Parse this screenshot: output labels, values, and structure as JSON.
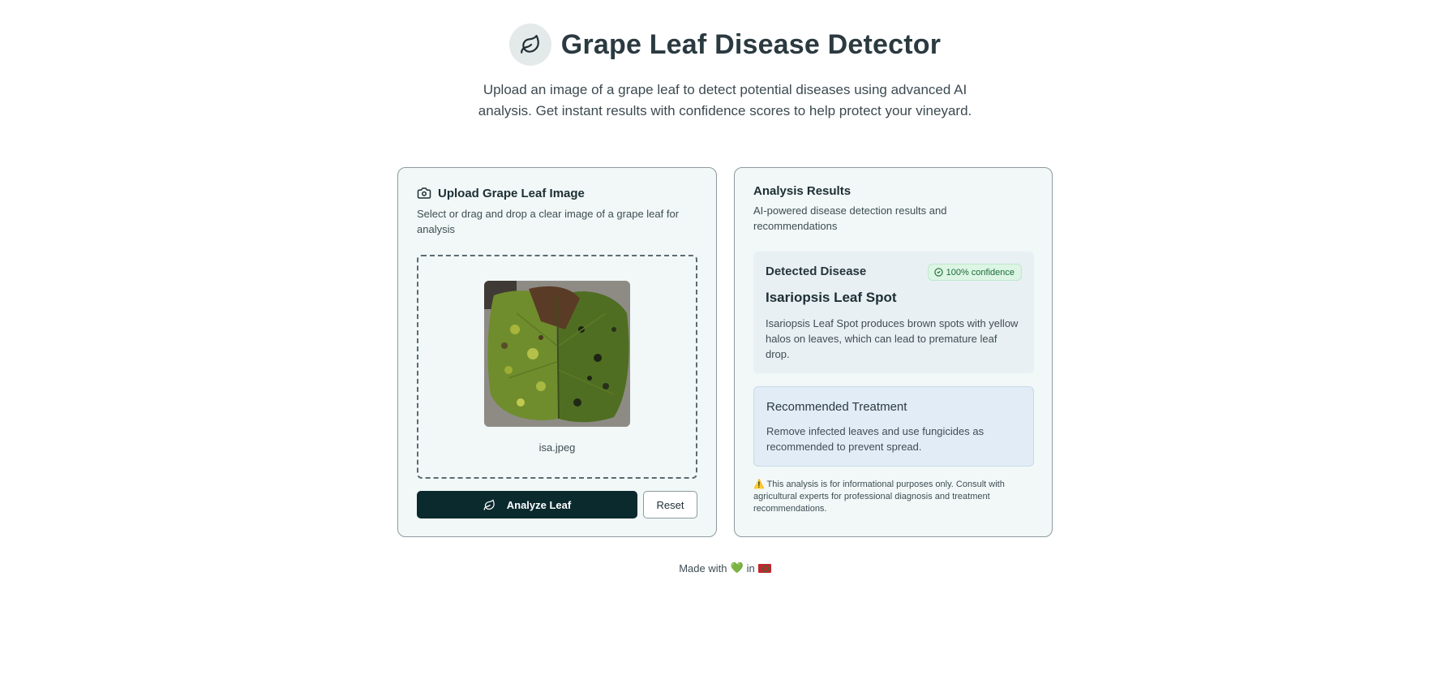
{
  "app": {
    "title": "Grape Leaf Disease Detector",
    "subtitle": "Upload an image of a grape leaf to detect potential diseases using advanced AI analysis. Get instant results with confidence scores to help protect your vineyard.",
    "logo_icon": "leaf-icon"
  },
  "upload": {
    "title": "Upload Grape Leaf Image",
    "title_icon": "camera-icon",
    "description": "Select or drag and drop a clear image of a grape leaf for analysis",
    "filename": "isa.jpeg",
    "analyze_label": "Analyze Leaf",
    "analyze_icon": "leaf-icon",
    "reset_label": "Reset"
  },
  "results": {
    "title": "Analysis Results",
    "description": "AI-powered disease detection results and recommendations",
    "disease_label": "Detected Disease",
    "confidence": "100% confidence",
    "confidence_icon": "check-circle-icon",
    "disease_name": "Isariopsis Leaf Spot",
    "disease_description": "Isariopsis Leaf Spot produces brown spots with yellow halos on leaves, which can lead to premature leaf drop.",
    "treatment_label": "Recommended Treatment",
    "treatment_description": "Remove infected leaves and use fungicides as recommended to prevent spread.",
    "disclaimer": "⚠️ This analysis is for informational purposes only. Consult with agricultural experts for professional diagnosis and treatment recommendations."
  },
  "footer": {
    "made_with": "Made with",
    "heart": "💚",
    "in": "in"
  },
  "colors": {
    "accent": "#0b2a2e",
    "card_bg": "#f1f8f7",
    "badge_bg": "#dcf5e4",
    "badge_text": "#1f6b3a",
    "treatment_bg": "#e2ecf6"
  }
}
